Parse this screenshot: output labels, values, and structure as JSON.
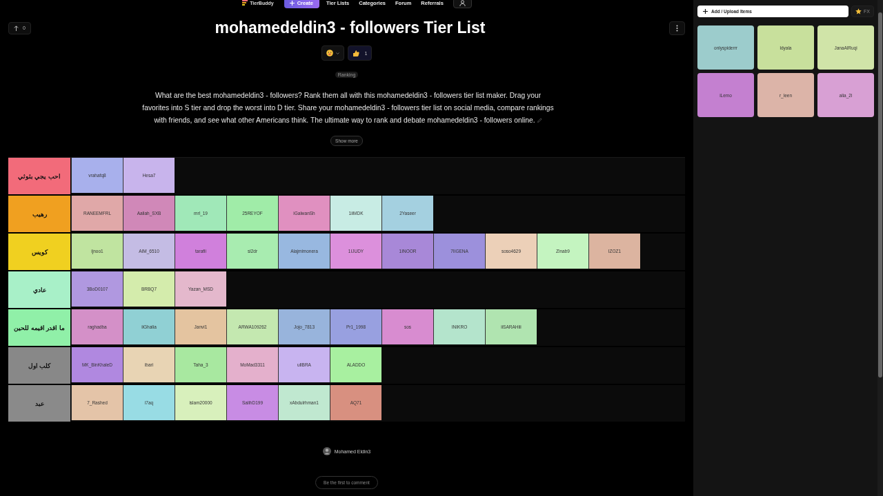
{
  "nav": {
    "logo": "TierBuddy",
    "create": "Create",
    "links": [
      "Tier Lists",
      "Categories",
      "Forum",
      "Referrals"
    ]
  },
  "upvote": {
    "count": "0"
  },
  "title": "mohamedeldin3 - followers Tier List",
  "reactions": {
    "likes": "1"
  },
  "tag": "Ranking",
  "description": "What are the best mohamedeldin3 - followers? Rank them all with this mohamedeldin3 - followers tier list maker. Drag your favorites into S tier and drop the worst into D tier. Share your mohamedeldin3 - followers tier list on social media, compare rankings with friends, and see what other Americans think. The ultimate way to rank and debate mohamedeldin3 - followers online.",
  "show_more": "Show more",
  "tiers": [
    {
      "label": "احب يجي بثوثي",
      "color": "#f26b7a",
      "items": [
        {
          "name": "vrahafq8",
          "color": "#a8b0ec"
        },
        {
          "name": "Hesa7",
          "color": "#c8b4ec"
        }
      ]
    },
    {
      "label": "رهيب",
      "color": "#f0a020",
      "items": [
        {
          "name": "RANEEMFRL",
          "color": "#e0a8a8"
        },
        {
          "name": "Aaliah_SXB",
          "color": "#d088b8"
        },
        {
          "name": "mrl_19",
          "color": "#a0e8b8"
        },
        {
          "name": "25REYOF",
          "color": "#a0eca8"
        },
        {
          "name": "iGalwanSh",
          "color": "#e090c0"
        },
        {
          "name": "1iiMDK",
          "color": "#c8ece4"
        },
        {
          "name": "2Yaseer",
          "color": "#a4d0e0"
        }
      ]
    },
    {
      "label": "كويس",
      "color": "#f0d020",
      "items": [
        {
          "name": "ijnoo1",
          "color": "#c0e4a0"
        },
        {
          "name": "AIM_6510",
          "color": "#c4bce4"
        },
        {
          "name": "tarafii",
          "color": "#d080dc"
        },
        {
          "name": "sl2dr",
          "color": "#a8ecb0"
        },
        {
          "name": "Alajmimonera",
          "color": "#98b8e0"
        },
        {
          "name": "1IJUDY",
          "color": "#dc90dc"
        },
        {
          "name": "1INOOR",
          "color": "#a888d8"
        },
        {
          "name": "7IIGENA",
          "color": "#9c90dc"
        },
        {
          "name": "soso4629",
          "color": "#ecd0b8"
        },
        {
          "name": "Zinab9",
          "color": "#c4f4c0"
        },
        {
          "name": "IZOZ1",
          "color": "#dcb4a0"
        }
      ]
    },
    {
      "label": "عادي",
      "color": "#a8f0c8",
      "items": [
        {
          "name": "3BoD0107",
          "color": "#b098e0"
        },
        {
          "name": "BRBQ7",
          "color": "#d4ecac"
        },
        {
          "name": "Yazan_MSD",
          "color": "#e4b8cc"
        }
      ]
    },
    {
      "label": "ما اقدر اقيمه للحين",
      "color": "#90f0a8",
      "items": [
        {
          "name": "raghadba",
          "color": "#d490c8"
        },
        {
          "name": "iiGhalia",
          "color": "#90d0d4"
        },
        {
          "name": "Janvi1",
          "color": "#e4c4a0"
        },
        {
          "name": "ARWA109262",
          "color": "#c4e8b0"
        },
        {
          "name": "Jojo_7813",
          "color": "#98b4dc"
        },
        {
          "name": "Pr1_1998",
          "color": "#98a0e0"
        },
        {
          "name": "sos",
          "color": "#d88cd0"
        },
        {
          "name": "INIKRO",
          "color": "#b4e4cc"
        },
        {
          "name": "iiSARAHiii",
          "color": "#b0e4b0"
        }
      ]
    },
    {
      "label": "كلب اول",
      "color": "#888888",
      "items": [
        {
          "name": "MK_BinKhaleD",
          "color": "#b088e0"
        },
        {
          "name": "ibari",
          "color": "#e8d4b4"
        },
        {
          "name": "Taha_3",
          "color": "#a8e8a0"
        },
        {
          "name": "MoMad3311",
          "color": "#e4b0cc"
        },
        {
          "name": "ullBRA",
          "color": "#c8b4f0"
        },
        {
          "name": "ALADDO",
          "color": "#a8f0a0"
        }
      ]
    },
    {
      "label": "عبد",
      "color": "#8a8a8a",
      "items": [
        {
          "name": "7_Rashed",
          "color": "#e4c4a8"
        },
        {
          "name": "i7aq",
          "color": "#98dce4"
        },
        {
          "name": "islam20000",
          "color": "#d8f0bc"
        },
        {
          "name": "SalihD199",
          "color": "#c88ce4"
        },
        {
          "name": "xAbdulrhman1",
          "color": "#c0e8d0"
        },
        {
          "name": "AQ71",
          "color": "#d89080"
        }
      ]
    }
  ],
  "author": "Mohamed Eldin3",
  "comment_button": "Be the first to comment",
  "panel": {
    "add_button": "Add / Upload Items",
    "fx_button": "FX",
    "items": [
      {
        "name": "onlyspiderrr",
        "color": "#9ccccc"
      },
      {
        "name": "ldyala",
        "color": "#c8e09c"
      },
      {
        "name": "JanaAlRuqi",
        "color": "#d0e4a8"
      },
      {
        "name": "iLemo",
        "color": "#c480d0"
      },
      {
        "name": "r_leen",
        "color": "#dcb4a8"
      },
      {
        "name": "alia_2i",
        "color": "#d8a0d4"
      }
    ]
  }
}
